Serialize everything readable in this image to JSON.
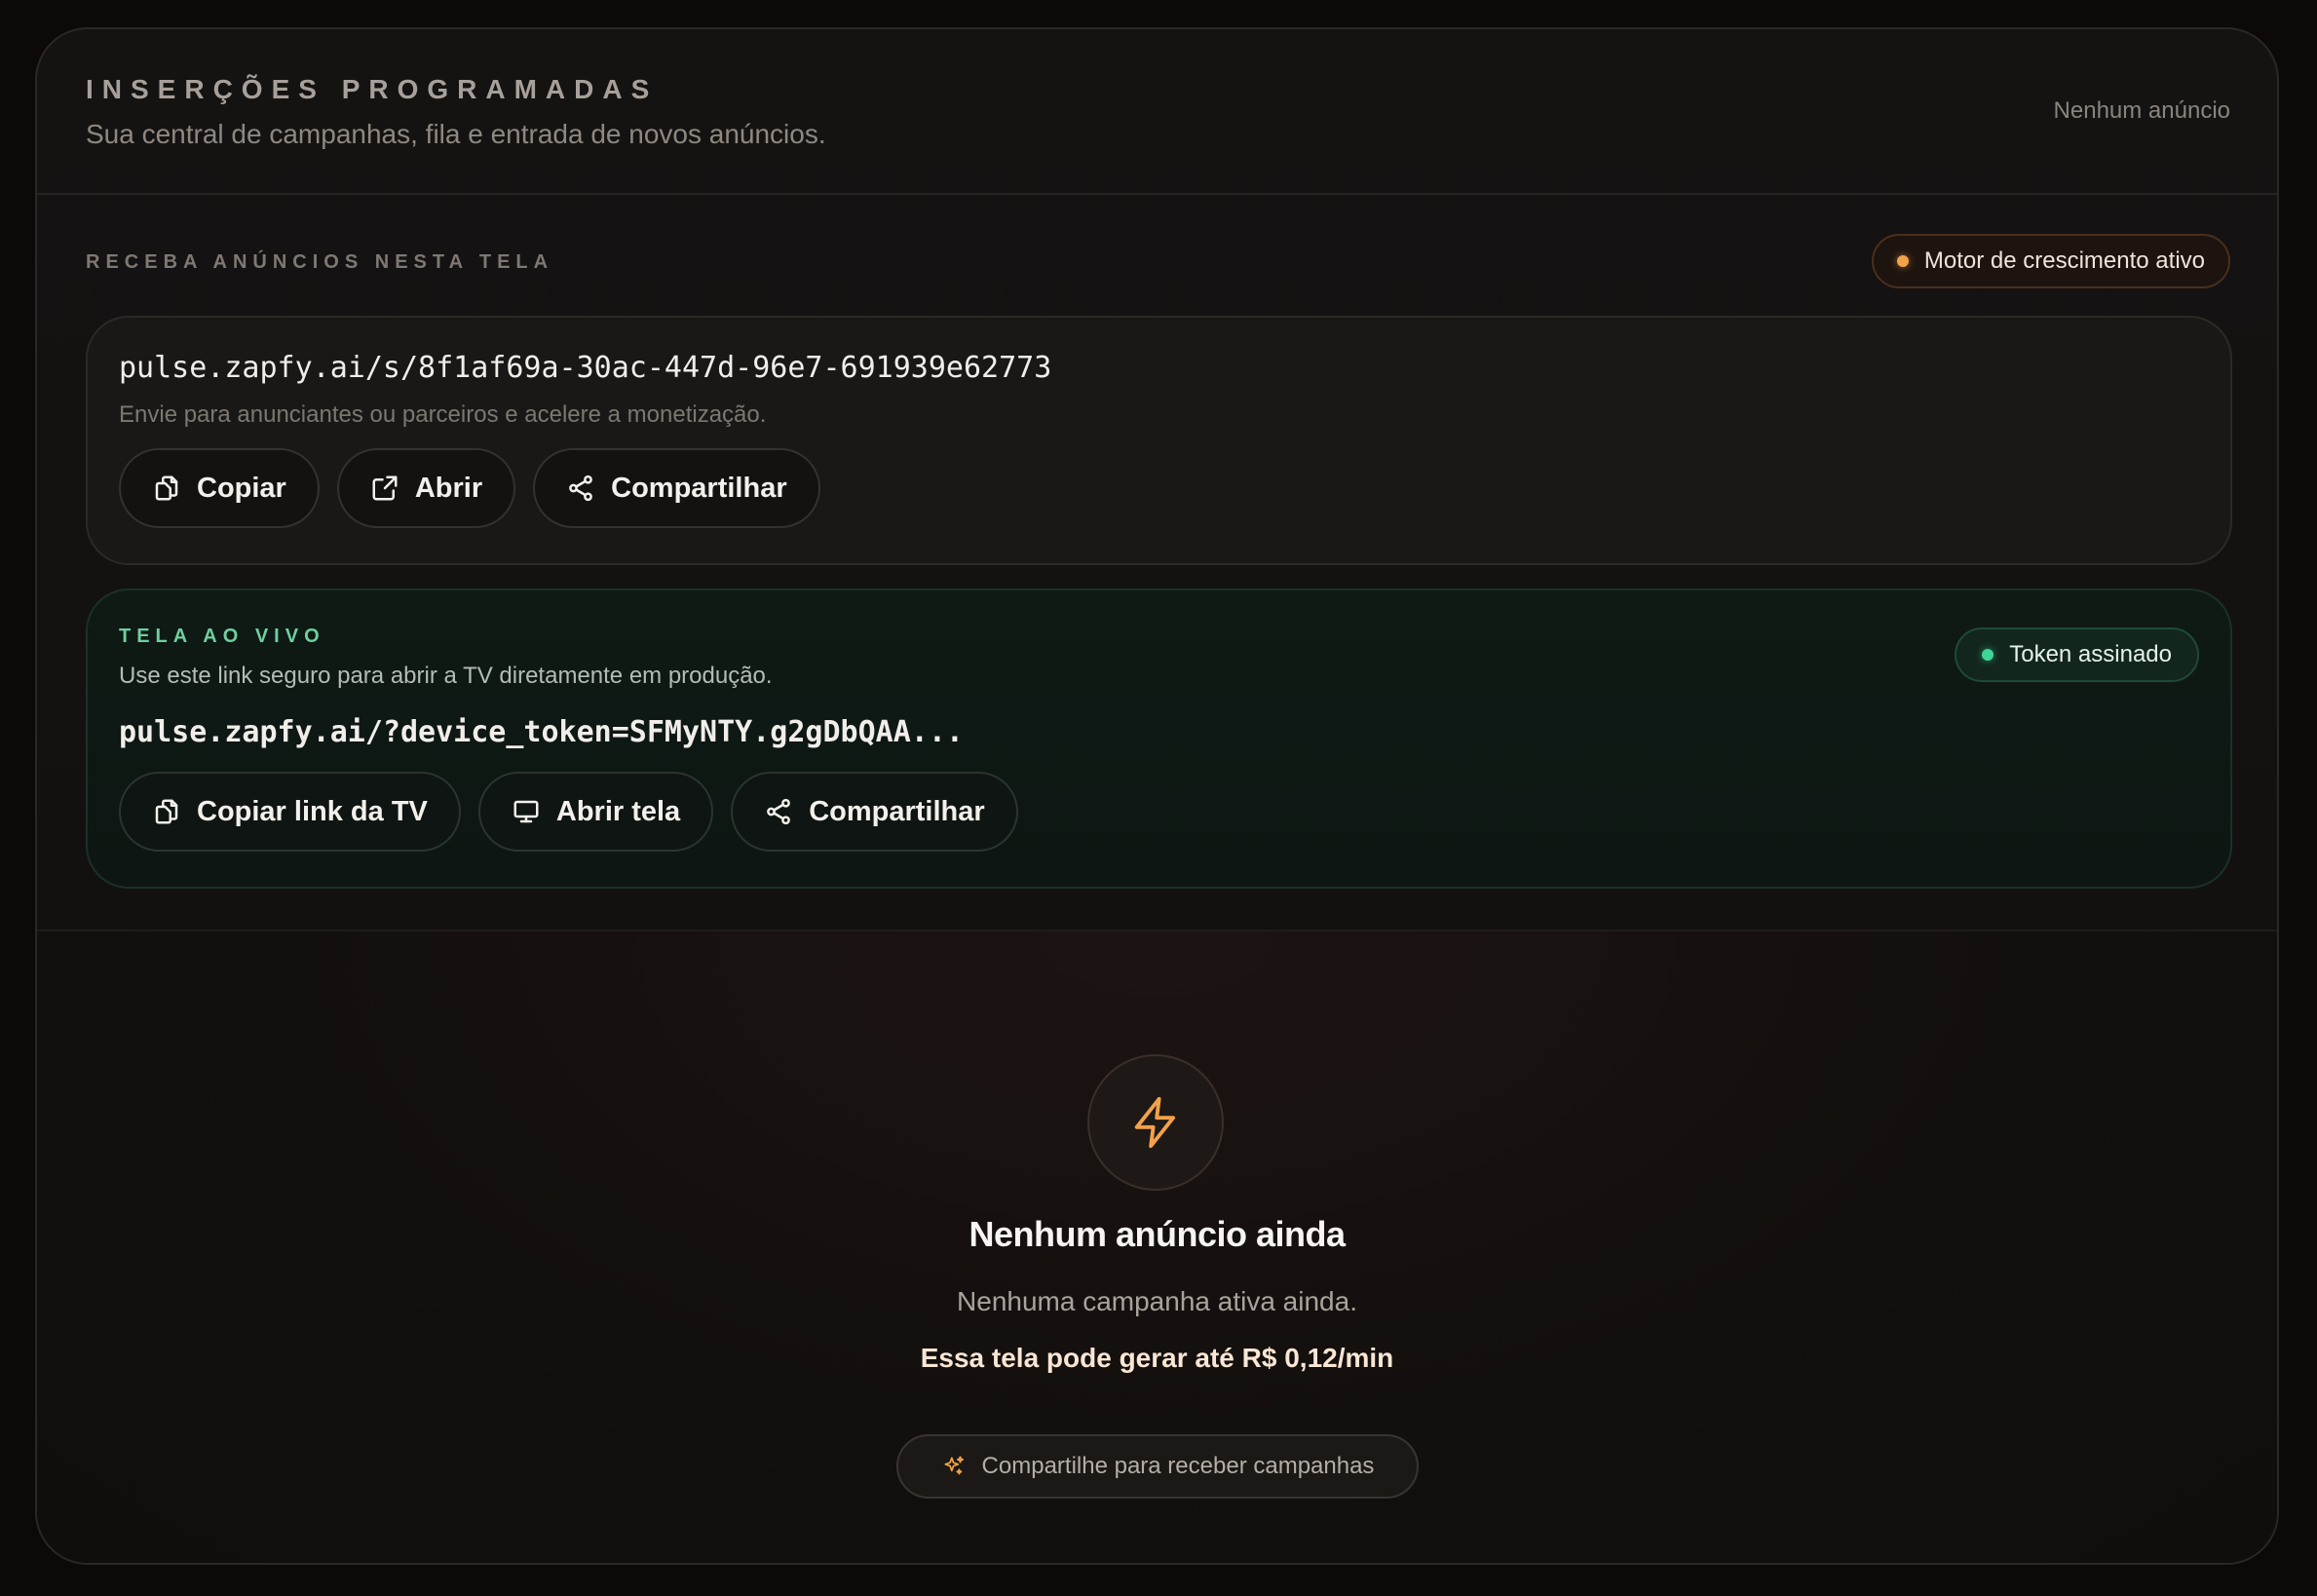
{
  "header": {
    "title": "INSERÇÕES PROGRAMADAS",
    "subtitle": "Sua central de campanhas, fila e entrada de novos anúncios.",
    "count_label": "Nenhum anúncio"
  },
  "receive": {
    "section_title": "RECEBA ANÚNCIOS NESTA TELA",
    "growth_badge": "Motor de crescimento ativo",
    "link_url": "pulse.zapfy.ai/s/8f1af69a-30ac-447d-96e7-691939e62773",
    "link_hint": "Envie para anunciantes ou parceiros e acelere a monetização.",
    "buttons": {
      "copy": "Copiar",
      "open": "Abrir",
      "share": "Compartilhar"
    }
  },
  "live": {
    "label": "TELA AO VIVO",
    "hint": "Use este link seguro para abrir a TV diretamente em produção.",
    "url": "pulse.zapfy.ai/?device_token=SFMyNTY.g2gDbQAA...",
    "token_badge": "Token assinado",
    "buttons": {
      "copy": "Copiar link da TV",
      "open": "Abrir tela",
      "share": "Compartilhar"
    }
  },
  "empty_state": {
    "icon": "bolt-icon",
    "title": "Nenhum anúncio ainda",
    "subtitle": "Nenhuma campanha ativa ainda.",
    "earnings": "Essa tela pode gerar até R$ 0,12/min",
    "cta": "Compartilhe para receber campanhas"
  },
  "colors": {
    "accent_orange": "#f2a24a",
    "accent_green": "#3ed598",
    "background": "#0c0908"
  }
}
